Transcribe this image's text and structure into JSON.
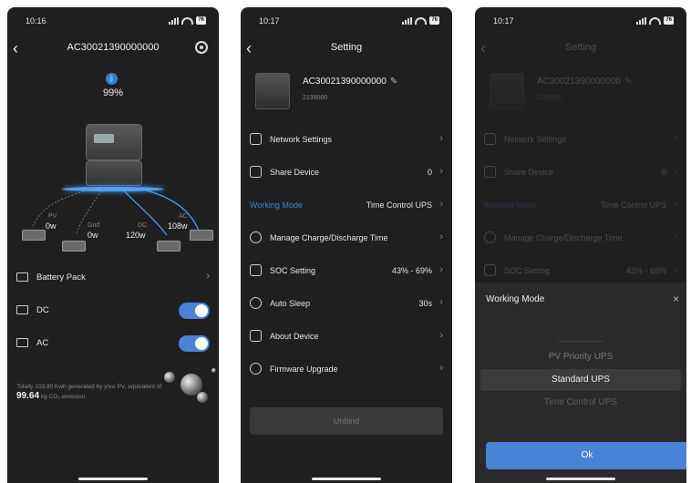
{
  "status_bars": [
    {
      "time": "10:16",
      "battery": "76"
    },
    {
      "time": "10:17",
      "battery": "76"
    },
    {
      "time": "10:17",
      "battery": "76"
    }
  ],
  "device_screen": {
    "title": "AC30021390000000",
    "battery_percent": "99%",
    "flows": {
      "pv": {
        "label": "PV",
        "value": "0w"
      },
      "grid": {
        "label": "Grid",
        "value": "0w"
      },
      "dc": {
        "label": "DC",
        "value": "120w"
      },
      "ac": {
        "label": "AC",
        "value": "108w"
      }
    },
    "rows": [
      {
        "label": "Battery Pack",
        "type": "chevron"
      },
      {
        "label": "DC",
        "type": "toggle",
        "on": true
      },
      {
        "label": "AC",
        "type": "toggle",
        "on": true
      }
    ],
    "info_prefix": "Totally 103.90 Kwh generated by your PV, equivalent of",
    "info_value": "99.64",
    "info_suffix": "kg CO₂ emission."
  },
  "settings": {
    "title": "Setting",
    "device_name": "AC30021390000000",
    "device_sub": "2139000",
    "items": [
      {
        "label": "Network Settings",
        "value": "",
        "icon": "network-icon"
      },
      {
        "label": "Share Device",
        "value": "0",
        "icon": "user-icon"
      },
      {
        "label": "Working Mode",
        "value": "Time Control UPS",
        "icon": ""
      },
      {
        "label": "Manage Charge/Discharge Time",
        "value": "",
        "icon": "clock-icon"
      },
      {
        "label": "SOC Setting",
        "value": "43% - 69%",
        "icon": "battery-icon"
      },
      {
        "label": "Auto Sleep",
        "value": "30s",
        "icon": "sleep-icon"
      },
      {
        "label": "About Device",
        "value": "",
        "icon": "info-icon"
      },
      {
        "label": "Firmware Upgrade",
        "value": "",
        "icon": "upgrade-icon"
      }
    ],
    "unbind": "Unbind"
  },
  "working_mode_sheet": {
    "title": "Working Mode",
    "close": "×",
    "options": [
      "PV Priority UPS",
      "Standard UPS",
      "Time Control UPS"
    ],
    "selected": "Standard UPS",
    "ok": "Ok"
  },
  "colors": {
    "accent": "#4a82d6",
    "background": "#1f1f1f"
  }
}
